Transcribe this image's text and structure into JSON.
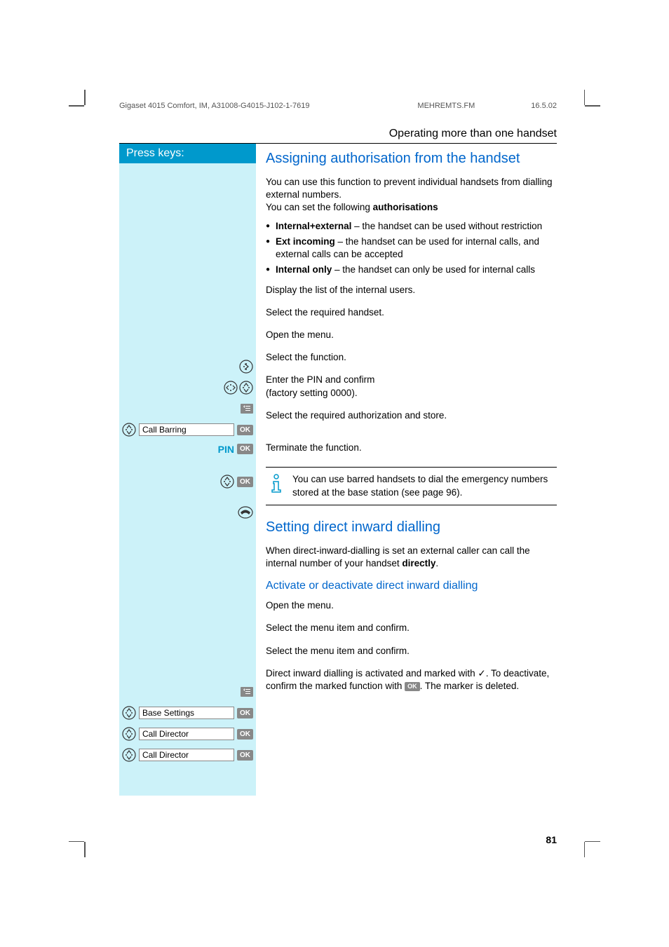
{
  "header": {
    "doc_id": "Gigaset 4015 Comfort, IM, A31008-G4015-J102-1-7619",
    "file": "MEHREMTS.FM",
    "date": "16.5.02"
  },
  "section_title": "Operating more than one handset",
  "press_keys_label": "Press keys:",
  "section1": {
    "heading": "Assigning authorisation from the handset",
    "intro1": "You can use this function to prevent individual handsets from dialling external numbers.",
    "intro2a": "You can set the following ",
    "intro2b": "authorisations",
    "bullets": [
      {
        "bold": "Internal+external",
        "rest": " – the handset can be used without restriction"
      },
      {
        "bold": "Ext incoming",
        "rest": " – the handset can be used for internal calls, and external calls can be accepted"
      },
      {
        "bold": "Internal only",
        "rest": "  – the handset can only be used for internal calls"
      }
    ],
    "steps_right": [
      "Display the list of the internal users.",
      "Select the required handset.",
      "Open the menu.",
      "Select the function.",
      "Enter the PIN and confirm\n(factory setting 0000).",
      "Select the required authorization and store.",
      "Terminate the function."
    ],
    "info_note": "You can use barred handsets to dial the emergency numbers stored at the base station (see page 96).",
    "left_labels": {
      "call_barring": "Call Barring",
      "pin": "PIN"
    }
  },
  "section2": {
    "heading": "Setting direct inward dialling",
    "intro_a": "When direct-inward-dialling is set an external caller can call the internal number of your handset ",
    "intro_b": "directly",
    "intro_c": ".",
    "subheading": "Activate or deactivate direct inward dialling",
    "steps_right": [
      "Open the menu.",
      "Select the menu item and confirm.",
      "Select the menu item and confirm.",
      "Direct inward dialling is activated and marked with ✓. To deactivate, confirm the marked function with",
      ". The marker is deleted."
    ],
    "left_labels": {
      "base_settings": "Base Settings",
      "call_director": "Call Director"
    }
  },
  "ok_label": "OK",
  "page_number": "81"
}
